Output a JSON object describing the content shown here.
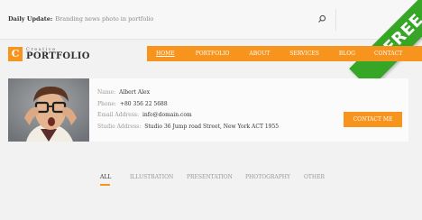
{
  "topbar": {
    "daily_label": "Daily Update:",
    "daily_text": "Branding news photo in portfolio"
  },
  "ribbon": {
    "label": "FREE"
  },
  "logo": {
    "letter": "C",
    "line1": "Creative",
    "line2": "PORTFOLIO"
  },
  "nav": {
    "items": [
      {
        "label": "HOME"
      },
      {
        "label": "PORTFOLIO"
      },
      {
        "label": "ABOUT"
      },
      {
        "label": "SERVICES"
      },
      {
        "label": "BLOG"
      },
      {
        "label": "CONTACT"
      }
    ]
  },
  "profile": {
    "fields": [
      {
        "label": "Name:",
        "value": "Albert Alex"
      },
      {
        "label": "Phone:",
        "value": "+80 356 22 5688"
      },
      {
        "label": "Email Address:",
        "value": "info@domain.com"
      },
      {
        "label": "Studio Address:",
        "value": "Studio 36 Jump road Street, New York ACT 1955"
      }
    ],
    "contact_button": "CONTACT ME"
  },
  "filters": {
    "items": [
      {
        "label": "ALL"
      },
      {
        "label": "ILLUSTRATION"
      },
      {
        "label": "PRESENTATION"
      },
      {
        "label": "PHOTOGRAPHY"
      },
      {
        "label": "OTHER"
      }
    ]
  },
  "colors": {
    "accent": "#f7941d",
    "ribbon": "#37a627",
    "background": "#f2f2f2"
  }
}
